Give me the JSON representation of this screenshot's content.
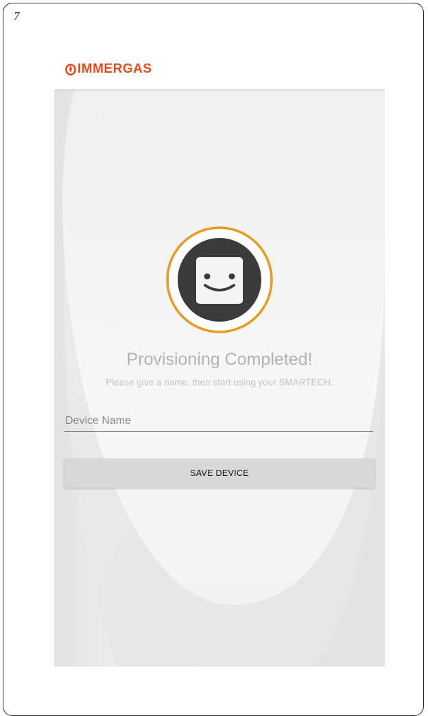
{
  "page": {
    "number": "7"
  },
  "brand": {
    "name": "IMMERGAS",
    "color": "#e64a19"
  },
  "screen": {
    "title": "Provisioning Completed!",
    "subtitle": "Please give a name, then start using your SMARTECH.",
    "device_name_placeholder": "Device Name",
    "device_name_value": "",
    "save_button_label": "SAVE DEVICE",
    "icon": "robot-face-icon",
    "accent_color": "#e89a1e"
  }
}
